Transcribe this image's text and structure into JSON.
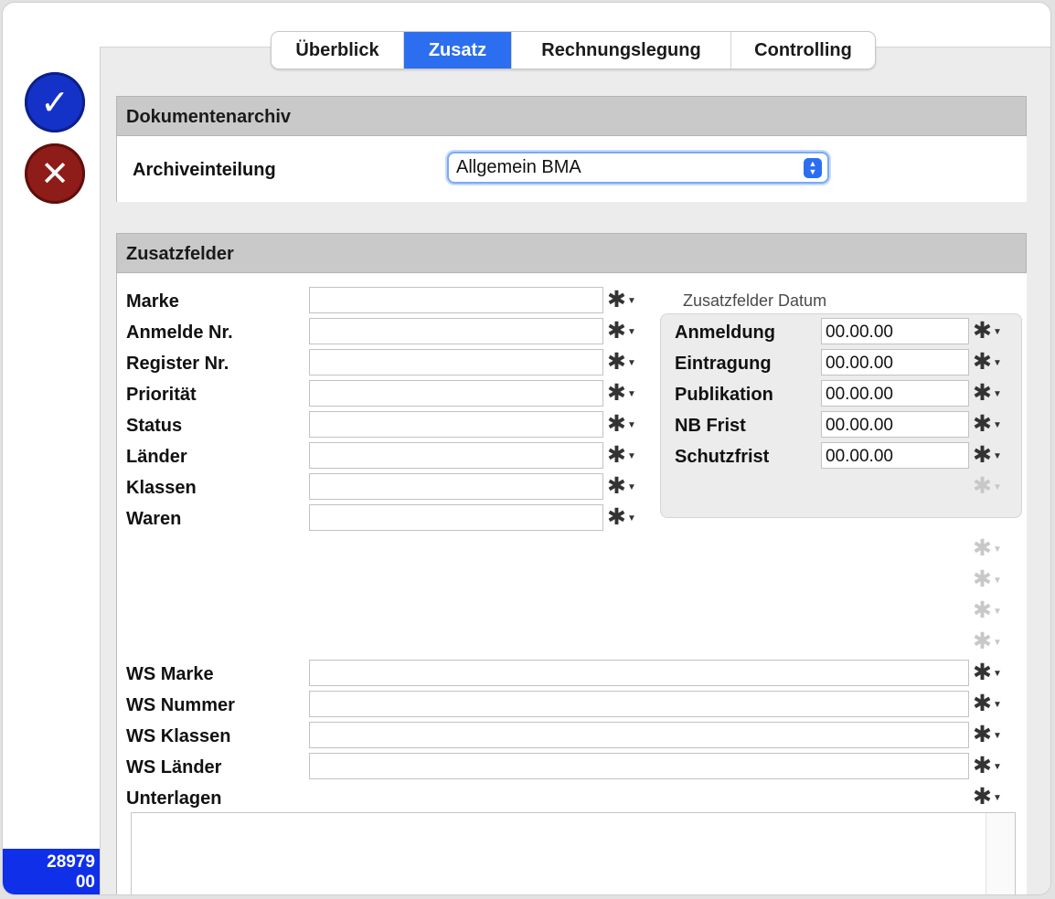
{
  "side": {
    "confirm_icon": "checkmark-icon",
    "cancel_icon": "close-icon",
    "record_id_line1": "28979",
    "record_id_line2": "00",
    "colors": {
      "confirm": "#1432c8",
      "cancel": "#8e1c18",
      "id_bg": "#0f2fe8"
    }
  },
  "tabs": [
    {
      "label": "Überblick",
      "active": false
    },
    {
      "label": "Zusatz",
      "active": true
    },
    {
      "label": "Rechnungslegung",
      "active": false
    },
    {
      "label": "Controlling",
      "active": false
    }
  ],
  "accent_color": "#2b6ff0",
  "dokumentenarchiv": {
    "title": "Dokumentenarchiv",
    "field_label": "Archiveinteilung",
    "selected_value": "Allgemein BMA"
  },
  "zusatzfelder": {
    "title": "Zusatzfelder",
    "fields": [
      {
        "label": "Marke",
        "value": ""
      },
      {
        "label": "Anmelde Nr.",
        "value": ""
      },
      {
        "label": "Register Nr.",
        "value": ""
      },
      {
        "label": "Priorität",
        "value": ""
      },
      {
        "label": "Status",
        "value": ""
      },
      {
        "label": "Länder",
        "value": ""
      },
      {
        "label": "Klassen",
        "value": ""
      },
      {
        "label": "Waren",
        "value": ""
      }
    ],
    "dates": {
      "title": "Zusatzfelder Datum",
      "fields": [
        {
          "label": "Anmeldung",
          "value": "00.00.00"
        },
        {
          "label": "Eintragung",
          "value": "00.00.00"
        },
        {
          "label": "Publikation",
          "value": "00.00.00"
        },
        {
          "label": "NB Frist",
          "value": "00.00.00"
        },
        {
          "label": "Schutzfrist",
          "value": "00.00.00"
        }
      ]
    },
    "ws_fields": [
      {
        "label": "WS Marke",
        "value": ""
      },
      {
        "label": "WS Nummer",
        "value": ""
      },
      {
        "label": "WS Klassen",
        "value": ""
      },
      {
        "label": "WS Länder",
        "value": ""
      }
    ],
    "notes_label": "Unterlagen",
    "notes_value": ""
  },
  "gear_icon": {
    "glyph": "✱",
    "caret": "▼"
  }
}
